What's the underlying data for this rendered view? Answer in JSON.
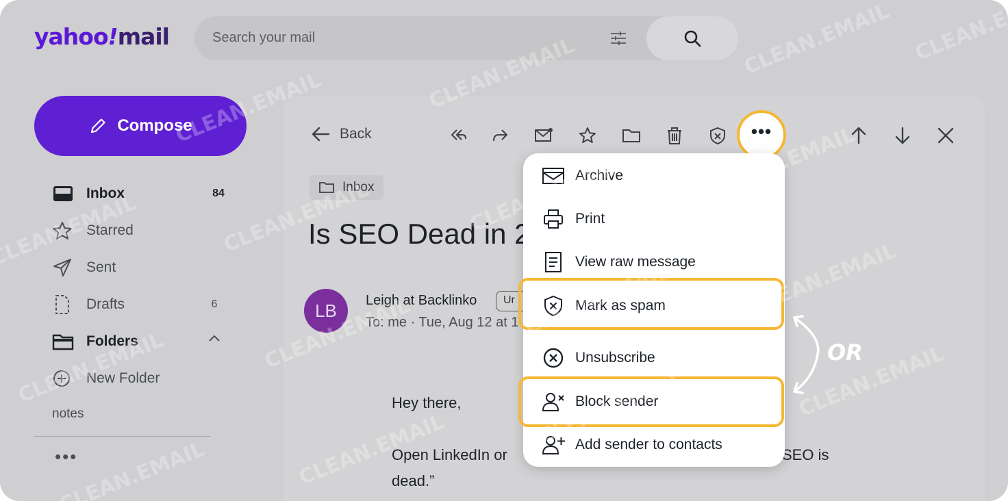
{
  "app": {
    "logo_text": "yahoo!mail"
  },
  "search": {
    "placeholder": "Search your mail"
  },
  "sidebar": {
    "compose_label": "Compose",
    "items": [
      {
        "label": "Inbox",
        "count": "84",
        "icon": "inbox-icon"
      },
      {
        "label": "Starred",
        "count": "",
        "icon": "star-icon"
      },
      {
        "label": "Sent",
        "count": "",
        "icon": "paper-plane-icon"
      },
      {
        "label": "Drafts",
        "count": "6",
        "icon": "draft-icon"
      },
      {
        "label": "Folders",
        "count": "",
        "icon": "folder-icon"
      },
      {
        "label": "New Folder",
        "count": "",
        "icon": "plus-circle-icon"
      }
    ],
    "notes_label": "notes",
    "more_label": "•••"
  },
  "toolbar": {
    "back_label": "Back",
    "more_label": "•••"
  },
  "message": {
    "folder_chip": "Inbox",
    "subject": "Is SEO Dead in 2",
    "avatar_initials": "LB",
    "sender": "Leigh at Backlinko",
    "unsub_chip": "Ur",
    "to_line": "To:  me · Tue, Aug 12 at 1",
    "greeting": "Hey there,",
    "line1_start": "Open LinkedIn or",
    "line1_end": "SEO is",
    "line2": "dead.”"
  },
  "menu": {
    "items": [
      {
        "label": "Archive",
        "icon": "archive-icon"
      },
      {
        "label": "Print",
        "icon": "printer-icon"
      },
      {
        "label": "View raw message",
        "icon": "document-icon"
      },
      {
        "label": "Mark as spam",
        "icon": "spam-shield-icon"
      },
      {
        "label": "Unsubscribe",
        "icon": "unsubscribe-icon"
      },
      {
        "label": "Block sender",
        "icon": "block-user-icon"
      },
      {
        "label": "Add sender to contacts",
        "icon": "add-user-icon"
      }
    ]
  },
  "annotation": {
    "or_label": "OR",
    "highlight_color": "#f5b834"
  },
  "watermark": {
    "text": "CLEAN.EMAIL"
  },
  "colors": {
    "brand_purple": "#5f1fd3",
    "avatar_purple": "#7a2f9d"
  }
}
